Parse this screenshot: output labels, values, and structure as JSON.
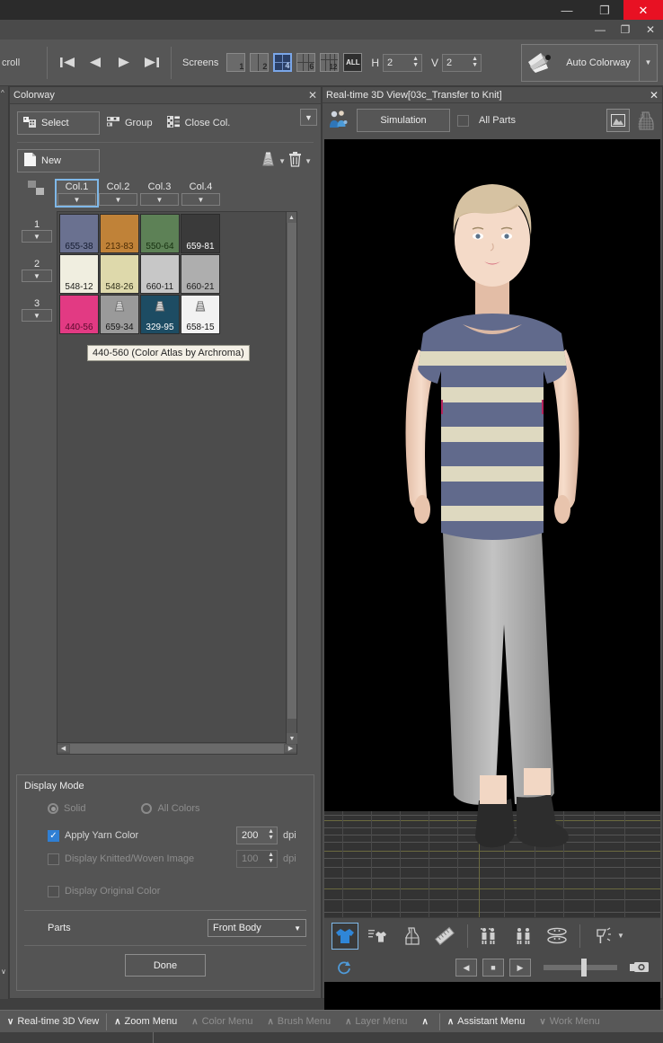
{
  "window": {
    "outer_buttons": [
      "—",
      "❐",
      "✕"
    ],
    "inner_buttons": [
      "—",
      "❐",
      "✕"
    ]
  },
  "toolbar": {
    "scroll_label": "croll",
    "nav": [
      "first-icon",
      "prev-icon",
      "play-icon",
      "last-icon"
    ],
    "screens_label": "Screens",
    "screen_options": [
      "1",
      "2",
      "4",
      "6",
      "12",
      "ALL"
    ],
    "screen_selected": "4",
    "h_label": "H",
    "h_value": "2",
    "v_label": "V",
    "v_value": "2",
    "auto_colorway_label": "Auto Colorway"
  },
  "colorway": {
    "title": "Colorway",
    "close": "✕",
    "buttons": {
      "select": "Select",
      "group": "Group",
      "close_col": "Close Col.",
      "new": "New",
      "expand": "▼"
    },
    "columns": [
      {
        "label": "Col.1",
        "selected": true
      },
      {
        "label": "Col.2",
        "selected": false
      },
      {
        "label": "Col.3",
        "selected": false
      },
      {
        "label": "Col.4",
        "selected": false
      }
    ],
    "rows": [
      "1",
      "2",
      "3"
    ],
    "swatches": [
      [
        {
          "code": "655-38",
          "color": "#6a7190",
          "text": "#141b30",
          "cone": false
        },
        {
          "code": "213-83",
          "color": "#c08238",
          "text": "#4c2c05",
          "cone": false
        },
        {
          "code": "550-64",
          "color": "#5d8156",
          "text": "#16300f",
          "cone": false
        },
        {
          "code": "659-81",
          "color": "#3a3a3a",
          "text": "#ffffff",
          "cone": false
        }
      ],
      [
        {
          "code": "548-12",
          "color": "#f0eee0",
          "text": "#1c1c18",
          "cone": false
        },
        {
          "code": "548-26",
          "color": "#ded9ab",
          "text": "#30301a",
          "cone": false
        },
        {
          "code": "660-11",
          "color": "#c7c7c7",
          "text": "#1c1c1c",
          "cone": false
        },
        {
          "code": "660-21",
          "color": "#aeaeae",
          "text": "#1c1c1c",
          "cone": false
        }
      ],
      [
        {
          "code": "440-56",
          "color": "#e23a83",
          "text": "#5a0a2c",
          "cone": false
        },
        {
          "code": "659-34",
          "color": "#9a9a9a",
          "text": "#151515",
          "cone": true
        },
        {
          "code": "329-95",
          "color": "#1d4c63",
          "text": "#ffffff",
          "cone": true
        },
        {
          "code": "658-15",
          "color": "#f2f2f2",
          "text": "#151515",
          "cone": true
        }
      ]
    ],
    "tooltip": "440-560 (Color Atlas by Archroma)"
  },
  "display_mode": {
    "title": "Display Mode",
    "solid_label": "Solid",
    "solid_checked": true,
    "all_colors_label": "All Colors",
    "all_colors_checked": false,
    "apply_yarn_label": "Apply Yarn Color",
    "apply_yarn_checked": true,
    "apply_yarn_dpi": "200",
    "knitted_label": "Display Knitted/Woven Image",
    "knitted_checked": false,
    "knitted_dpi": "100",
    "dpi_unit": "dpi",
    "original_color_label": "Display Original Color",
    "original_color_checked": false,
    "parts_label": "Parts",
    "parts_value": "Front Body",
    "done_label": "Done"
  },
  "view3d": {
    "title": "Real-time 3D View[03c_Transfer to Knit]",
    "close": "✕",
    "simulation_label": "Simulation",
    "all_parts_label": "All Parts",
    "all_parts_checked": false,
    "header_icons": [
      "avatar-pair-icon",
      "image-preview-icon",
      "mannequin-icon"
    ],
    "bottom_tools": [
      "garment-icon",
      "garment-list-icon",
      "dress-form-icon",
      "ruler-icon",
      "two-avatars-icon",
      "avatar-pose-icon",
      "mirror-icon",
      "lighting-icon"
    ],
    "playback": {
      "refresh": "refresh-icon",
      "prev": "◀",
      "stop": "■",
      "next": "▶",
      "camera": "camera-icon"
    }
  },
  "statusbar": {
    "items": [
      {
        "icon": "∨",
        "label": "Real-time 3D View",
        "dim": false
      },
      {
        "icon": "∧",
        "label": "Zoom Menu",
        "dim": false
      },
      {
        "icon": "∧",
        "label": "Color Menu",
        "dim": true
      },
      {
        "icon": "∧",
        "label": "Brush Menu",
        "dim": true
      },
      {
        "icon": "∧",
        "label": "Layer Menu",
        "dim": true
      },
      {
        "icon": "∧",
        "label": "",
        "dim": false
      },
      {
        "icon": "∧",
        "label": "Assistant Menu",
        "dim": false
      },
      {
        "icon": "∨",
        "label": "Work Menu",
        "dim": true
      }
    ]
  },
  "colors": {
    "accent": "#7fb8e8",
    "checkbox_on": "#2f7fd4",
    "close_red": "#e81123",
    "panel_bg": "#545454",
    "toolbar_bg": "#565656"
  }
}
